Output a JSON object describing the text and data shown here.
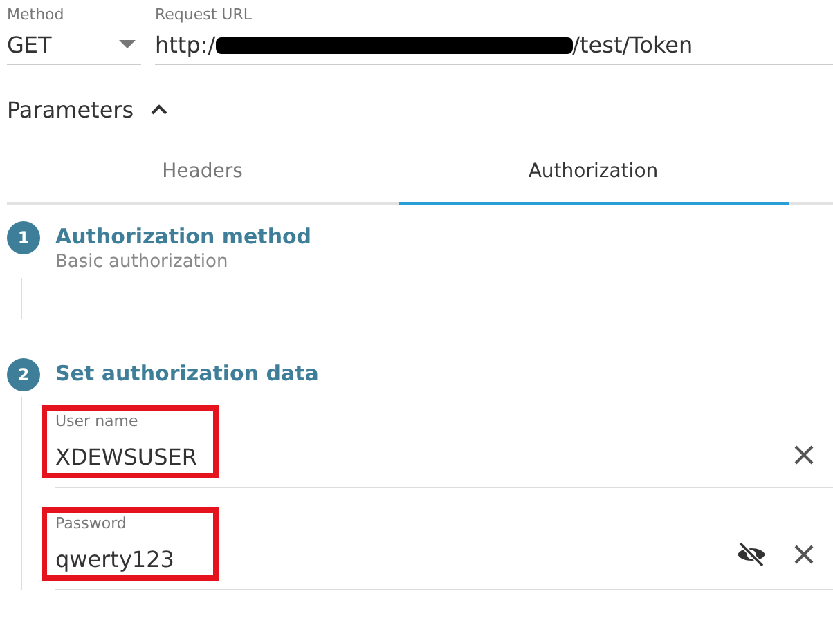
{
  "method": {
    "label": "Method",
    "value": "GET"
  },
  "request_url": {
    "label": "Request URL",
    "value_start": "http:/",
    "redacted": true,
    "value_end": "/test/Token"
  },
  "parameters": {
    "title": "Parameters",
    "expanded": true
  },
  "tabs": [
    {
      "label": "Headers",
      "selected": false
    },
    {
      "label": "Authorization",
      "selected": true
    }
  ],
  "steps": [
    {
      "number": "1",
      "title": "Authorization method",
      "subtitle": "Basic authorization"
    },
    {
      "number": "2",
      "title": "Set authorization data",
      "fields": [
        {
          "kind": "text",
          "label": "User name",
          "value": "XDEWSUSER",
          "highlighted": true
        },
        {
          "kind": "password",
          "label": "Password",
          "value": "qwerty123",
          "highlighted": true
        }
      ]
    }
  ]
}
